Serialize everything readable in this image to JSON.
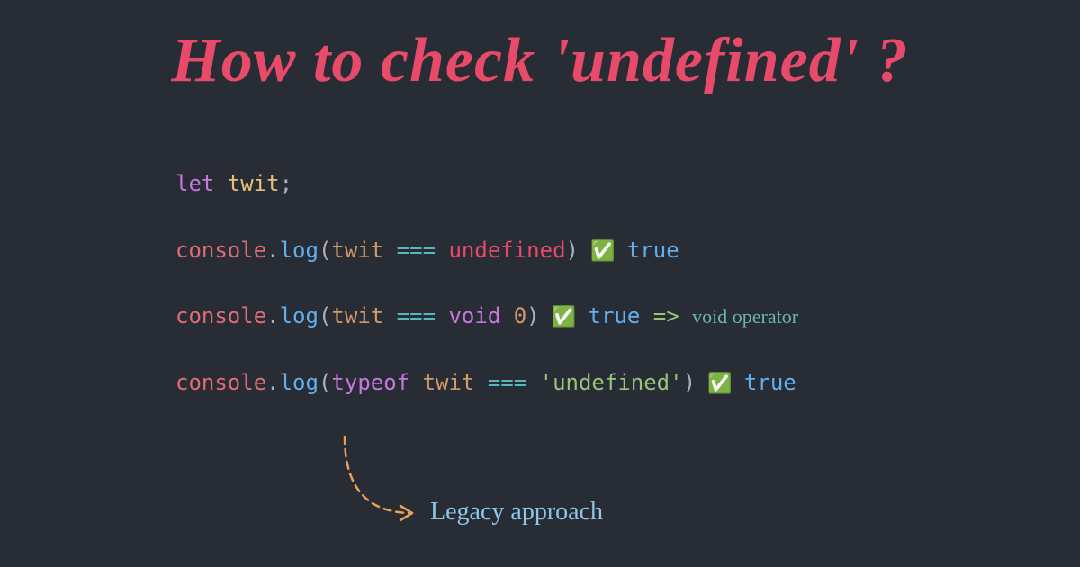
{
  "title": "How to check 'undefined' ?",
  "code": {
    "line1": {
      "let": "let",
      "ident": "twit",
      "semi": ";"
    },
    "line2": {
      "console": "console",
      "dot": ".",
      "log": "log",
      "lp": "(",
      "param": "twit",
      "op": " === ",
      "undef": "undefined",
      "rp": ")",
      "check": " ✅ ",
      "true": "true"
    },
    "line3": {
      "console": "console",
      "dot": ".",
      "log": "log",
      "lp": "(",
      "param": "twit",
      "op": " === ",
      "void": "void",
      "space": " ",
      "zero": "0",
      "rp": ")",
      "check": " ✅ ",
      "true": "true",
      "arrow": " => ",
      "note": "void operator"
    },
    "line4": {
      "console": "console",
      "dot": ".",
      "log": "log",
      "lp": "(",
      "typeof": "typeof",
      "space": " ",
      "param": "twit",
      "op": " === ",
      "string": "'undefined'",
      "rp": ")",
      "check": " ✅ ",
      "true": "true"
    }
  },
  "legacy_label": "Legacy approach"
}
